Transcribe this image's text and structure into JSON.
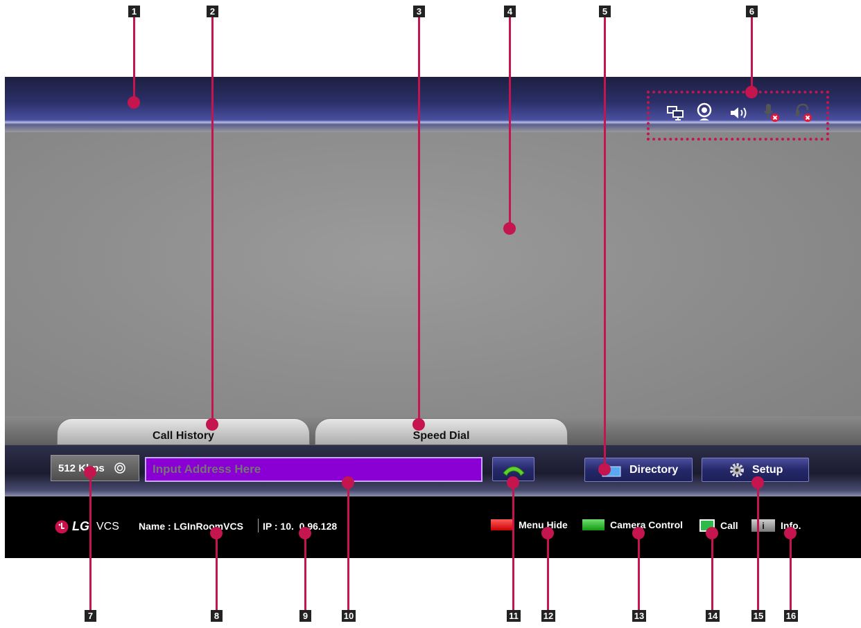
{
  "tabs": [
    "Call History",
    "Speed Dial"
  ],
  "bandwidth": {
    "label": "512 Kbps",
    "icon": "target-icon"
  },
  "address_input": {
    "placeholder": "Input Address Here"
  },
  "call_button": {
    "icon": "phone-handset-icon"
  },
  "directory_button": {
    "label": "Directory",
    "icon": "folder-icon"
  },
  "setup_button": {
    "label": "Setup",
    "icon": "gear-icon"
  },
  "status_icons": [
    "monitor-icon",
    "webcam-icon",
    "speaker-icon",
    "microphone-muted-icon",
    "headset-muted-icon"
  ],
  "footer": {
    "brand": "LG",
    "product": "VCS",
    "name_label": "Name : LGInRoomVCS",
    "ip_label": "IP : 10.  0.96.128",
    "hints": [
      {
        "key": "red-button",
        "label": "Menu Hide"
      },
      {
        "key": "green-button",
        "label": "Camera Control"
      },
      {
        "key": "call-key",
        "label": "Call"
      },
      {
        "key": "info-key",
        "label": "Info."
      }
    ]
  },
  "callouts": [
    "1",
    "2",
    "3",
    "4",
    "5",
    "6",
    "7",
    "8",
    "9",
    "10",
    "11",
    "12",
    "13",
    "14",
    "15",
    "16"
  ],
  "colors": {
    "address_bg": "#8a00d4",
    "callout": "#c4154f",
    "nav_button": "#25286a"
  }
}
